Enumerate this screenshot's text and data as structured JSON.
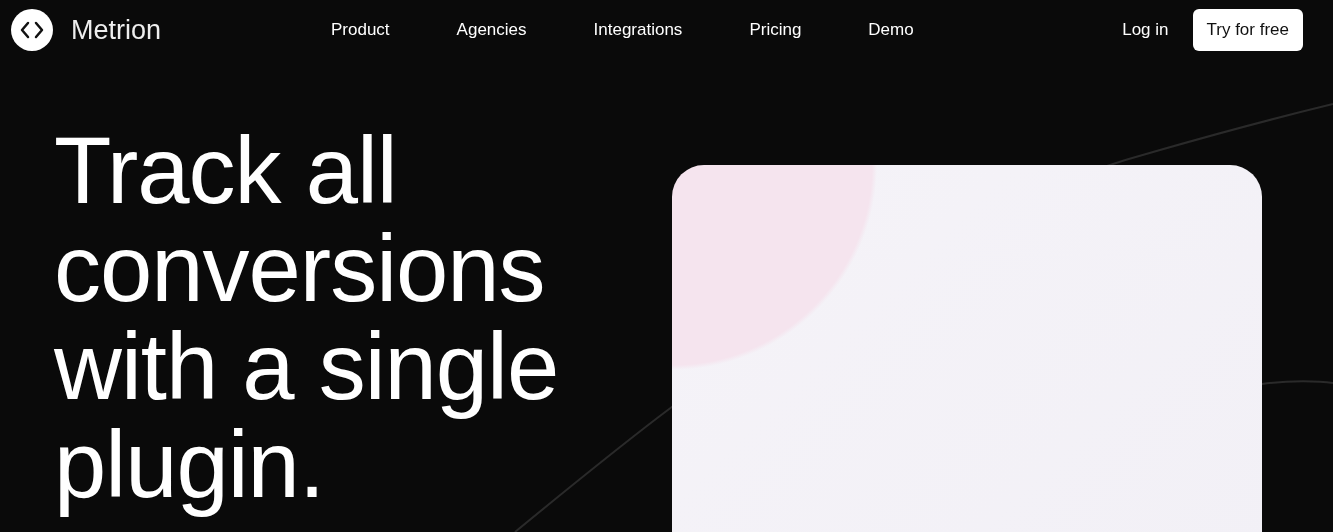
{
  "brand": {
    "name": "Metrion"
  },
  "nav": {
    "links": [
      "Product",
      "Agencies",
      "Integrations",
      "Pricing",
      "Demo"
    ],
    "login": "Log in",
    "cta": "Try for free"
  },
  "hero": {
    "headline_lines": [
      "Track all",
      "conversions",
      "with a single",
      "plugin."
    ]
  }
}
